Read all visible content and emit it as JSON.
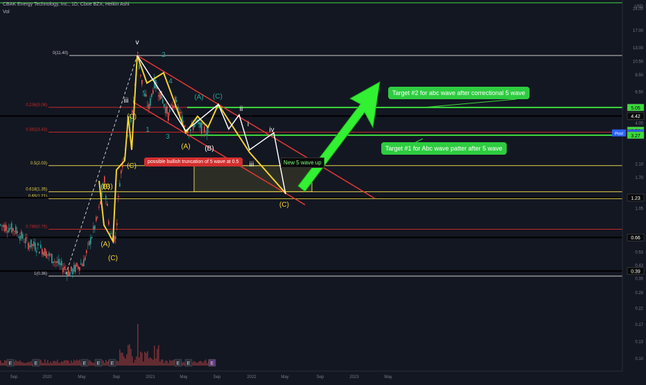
{
  "header": {
    "symbol_line": "CBAK Energy Technology, Inc., 1D, Cboe BZX, Heikin Ashi",
    "vol_label": "Vol"
  },
  "colors": {
    "background": "#131722",
    "up": "#26a69a",
    "down": "#ef5350",
    "fib_green": "#3ddc3d",
    "fib_yellow": "#e6d24a",
    "fib_red": "#c62828",
    "channel": "#e53935",
    "wave_yellow": "#f5d230",
    "wave_white": "#ffffff",
    "arrow": "#32f032"
  },
  "chart_data": {
    "type": "candlestick",
    "y_scale": "log",
    "y_axis_unit": "USD",
    "y_ticks": [
      "32.00",
      "24.00",
      "17.00",
      "13.00",
      "10.50",
      "8.50",
      "6.50",
      "4.00",
      "2.10",
      "1.70",
      "1.05",
      "0.53",
      "0.43",
      "0.35",
      "0.28",
      "0.22",
      "0.17",
      "0.13",
      "0.10"
    ],
    "x_ticks": [
      "Sep",
      "2020",
      "May",
      "Sep",
      "2021",
      "May",
      "Sep",
      "2022",
      "May",
      "Sep",
      "2023",
      "May"
    ],
    "price_labels": [
      {
        "value": "5.05",
        "color": "#3ddc3d"
      },
      {
        "value": "4.42",
        "color": "#0a0a0a"
      },
      {
        "value": "3.53",
        "color": "#3ddc3d"
      },
      {
        "value": "3.52",
        "color": "#2962ff",
        "tag": "Post"
      },
      {
        "value": "3.27",
        "color": "#3ddc3d"
      },
      {
        "value": "1.23",
        "color": "#0a0a0a"
      },
      {
        "value": "0.66",
        "color": "#0a0a0a"
      },
      {
        "value": "0.39",
        "color": "#0a0a0a"
      }
    ],
    "fib_levels": [
      {
        "label": "0(11.40)",
        "value": 11.4,
        "color": "#cccccc"
      },
      {
        "label": "0.236(5.06)",
        "value": 5.06,
        "color": "#c62828"
      },
      {
        "label": "0.382(3.43)",
        "value": 3.43,
        "color": "#c62828"
      },
      {
        "label": "0.5(2.03)",
        "value": 2.03,
        "color": "#e6d24a"
      },
      {
        "label": "0.618(1.35)",
        "value": 1.35,
        "color": "#e6d24a"
      },
      {
        "label": "0.65(1.21)",
        "value": 1.21,
        "color": "#e6d24a"
      },
      {
        "label": "0.786(0.75)",
        "value": 0.75,
        "color": "#c62828"
      },
      {
        "label": "1(0.36)",
        "value": 0.36,
        "color": "#cccccc"
      }
    ],
    "wave_labels": [
      "v",
      "2",
      "4",
      "1",
      "3",
      "iii",
      "(A)",
      "(C)",
      "(B)",
      "(A)",
      "(B)",
      "(C)",
      "(C)",
      "ii",
      "iv",
      "i",
      "iii",
      "(B)",
      "(A)",
      "(C)",
      "(C)"
    ],
    "annotations": {
      "target2": "Target #2 for abc wave after correctional 5 wave",
      "target1": "Target #1 for Abc wave patter after 5 wave",
      "truncation": "possible bullish truncation of 5 wave at 0.5",
      "new_wave": "New 5 wave up"
    },
    "earnings_markers": [
      "E",
      "E",
      "E",
      "E",
      "E",
      "E",
      "E",
      "E",
      "E"
    ]
  }
}
